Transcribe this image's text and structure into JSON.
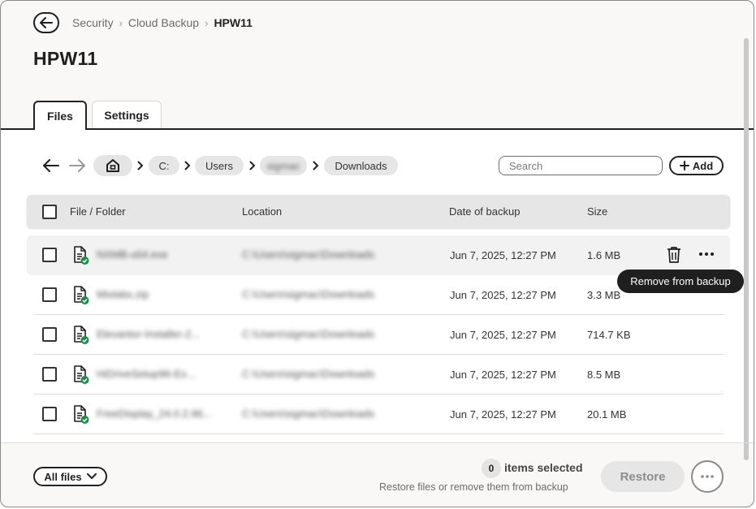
{
  "header": {
    "breadcrumb": [
      "Security",
      "Cloud Backup",
      "HPW11"
    ],
    "title": "HPW11"
  },
  "tabs": [
    {
      "label": "Files",
      "active": true
    },
    {
      "label": "Settings",
      "active": false
    }
  ],
  "path": {
    "drive": "C:",
    "users": "Users",
    "user_redacted": "sigmac",
    "folder": "Downloads"
  },
  "search": {
    "placeholder": "Search",
    "value": ""
  },
  "add_label": "Add",
  "table": {
    "columns": [
      "File / Folder",
      "Location",
      "Date of backup",
      "Size"
    ],
    "rows": [
      {
        "name": "NXMB-x64.exe",
        "location": "C:\\Users\\sigmac\\Downloads",
        "date": "Jun 7, 2025, 12:27 PM",
        "size": "1.6 MB"
      },
      {
        "name": "Mixlabs.zip",
        "location": "C:\\Users\\sigmac\\Downloads",
        "date": "Jun 7, 2025, 12:27 PM",
        "size": "3.3 MB"
      },
      {
        "name": "Elevantor-Installer-2...",
        "location": "C:\\Users\\sigmac\\Downloads",
        "date": "Jun 7, 2025, 12:27 PM",
        "size": "714.7 KB"
      },
      {
        "name": "HiDriveSetup96-Ex...",
        "location": "C:\\Users\\sigmac\\Downloads",
        "date": "Jun 7, 2025, 12:27 PM",
        "size": "8.5 MB"
      },
      {
        "name": "FreeDisplay_24.0.2.96...",
        "location": "C:\\Users\\sigmac\\Downloads",
        "date": "Jun 7, 2025, 12:27 PM",
        "size": "20.1 MB"
      }
    ]
  },
  "tooltip": "Remove from backup",
  "footer": {
    "filter_label": "All files",
    "selected_count": "0",
    "selected_label": "items selected",
    "hint": "Restore files or remove them from backup",
    "restore_label": "Restore"
  },
  "colors": {
    "accent": "#1f1f1f",
    "success": "#1a8a47",
    "disabled": "#e6e6e6"
  },
  "icons": [
    "back-arrow-icon",
    "home-icon",
    "file-check-icon",
    "trash-icon",
    "more-icon",
    "plus-icon",
    "chevron-down-icon"
  ]
}
